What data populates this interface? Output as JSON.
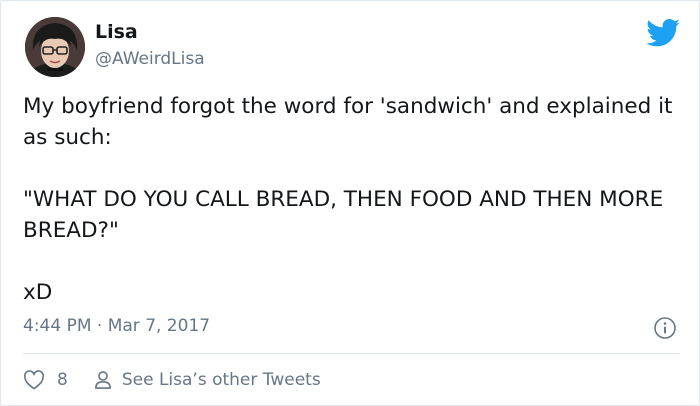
{
  "author": {
    "name": "Lisa",
    "handle": "@AWeirdLisa"
  },
  "tweet": {
    "paragraphs": [
      "My boyfriend forgot the word for 'sandwich' and explained it as such:",
      "\"WHAT DO YOU CALL BREAD, THEN FOOD AND THEN MORE BREAD?\"",
      "xD"
    ],
    "timestamp": "4:44 PM · Mar 7, 2017"
  },
  "actions": {
    "likes": "8",
    "other_tweets": "See Lisa’s other Tweets"
  },
  "colors": {
    "brand": "#1da1f2",
    "secondary_text": "#657786"
  },
  "icons": {
    "logo": "twitter-bird-icon",
    "info": "info-icon",
    "like": "heart-icon",
    "profile": "person-icon"
  }
}
